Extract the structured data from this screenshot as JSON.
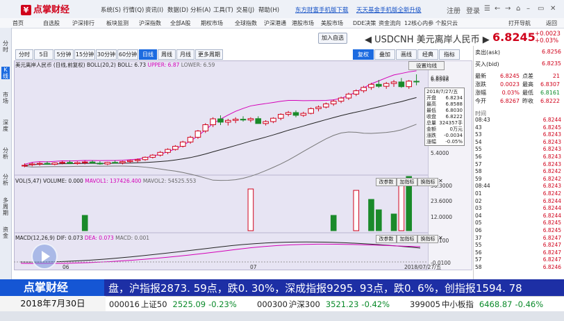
{
  "app": {
    "logo_text": "点掌财经",
    "brand_color": "#d0021b"
  },
  "menu": [
    "系统(S)",
    "行情(Q)",
    "资讯(I)",
    "数据(D)",
    "分析(A)",
    "工具(T)",
    "交易(J)",
    "帮助(H)"
  ],
  "top_links": [
    "东方财富手机版下载",
    "天天基金手机版全新升级"
  ],
  "top_right": [
    "注册",
    "登录"
  ],
  "nav": [
    "首页",
    "自选股",
    "沪深排行",
    "板块监测",
    "沪深指数",
    "全部A股",
    "期权市场",
    "全球指数",
    "沪深港通",
    "港股市场",
    "美股市场",
    "DDE决策",
    "资金流向",
    "12核心内参",
    "个股只云",
    "打开导航",
    "返回"
  ],
  "title": {
    "add_btn": "加入自选",
    "code": "USDCNH",
    "name": "美元离岸人民币",
    "price": "6.8245",
    "chg_abs": "+0.0023",
    "chg_pct": "+0.03%"
  },
  "sidebar": [
    "分时",
    "K线",
    "市场",
    "深度",
    "分析",
    "分析",
    "多周期",
    "资金"
  ],
  "chart_toolbar": [
    "分时",
    "5日",
    "5分钟",
    "15分钟",
    "30分钟",
    "60分钟",
    "日线",
    "周线",
    "月线",
    "更多周期"
  ],
  "chart_toolbar_right": [
    "复权",
    "叠加",
    "画线",
    "经典",
    "指标"
  ],
  "legend_main": {
    "name": "美元离岸人民币 (日线,前复权)",
    "boll": "BOLL(20,2)",
    "boll_val": "BOLL: 6.73",
    "upper": "UPPER: 6.87",
    "lower": "LOWER: 6.59"
  },
  "legend_vol": {
    "name": "VOL(5,47)",
    "vol": "VOLUME: 0.000",
    "mavol1": "MAVOL1: 137426.400",
    "mavol2": "MAVOL2: 54525.553"
  },
  "legend_macd": {
    "name": "MACD(12,26,9)",
    "dif": "DIF: 0.073",
    "dea": "DEA: 0.073",
    "macd": "MACD: 0.001"
  },
  "panel_buttons": [
    "改参数",
    "加指标",
    "换指标"
  ],
  "setting_btn": "设置均线",
  "popup": {
    "date": "2018/7/27/五",
    "rows": [
      [
        "开盘",
        "6.8234"
      ],
      [
        "最高",
        "6.8588"
      ],
      [
        "最低",
        "6.8030"
      ],
      [
        "收盘",
        "6.8222"
      ],
      [
        "总量",
        "324357手"
      ],
      [
        "金额",
        "0万元"
      ],
      [
        "涨跌",
        "-0.0034"
      ],
      [
        "涨幅",
        "-0.05%"
      ]
    ]
  },
  "price_axis": [
    "6.8302",
    "6.8568",
    "5.4000"
  ],
  "vol_axis": [
    "36.3000",
    "23.6000",
    "12.0000"
  ],
  "macd_axis": [
    "0.0100",
    "-0.0100"
  ],
  "x_axis": [
    "06",
    "07",
    "2018/07/27/五"
  ],
  "right_panel": {
    "sell_label": "卖出(ask)",
    "sell_val": "6.8256",
    "buy_label": "买入(bid)",
    "buy_val": "6.8235",
    "stats": [
      [
        "最新",
        "6.8245",
        "点差",
        "21"
      ],
      [
        "涨跌",
        "0.0023",
        "最高",
        "6.8307"
      ],
      [
        "涨幅",
        "0.03%",
        "最低",
        "6.8161"
      ],
      [
        "今开",
        "6.8267",
        "昨收",
        "6.8222"
      ]
    ],
    "tick_header": "时间",
    "ticks": [
      [
        "08:43",
        "6.8244"
      ],
      [
        "43",
        "6.8245"
      ],
      [
        "53",
        "6.8243"
      ],
      [
        "54",
        "6.8243"
      ],
      [
        "55",
        "6.8243"
      ],
      [
        "56",
        "6.8243"
      ],
      [
        "57",
        "6.8243"
      ],
      [
        "58",
        "6.8242"
      ],
      [
        "59",
        "6.8242"
      ],
      [
        "08:44",
        "6.8243"
      ],
      [
        "01",
        "6.8242"
      ],
      [
        "02",
        "6.8244"
      ],
      [
        "03",
        "6.8244"
      ],
      [
        "04",
        "6.8244"
      ],
      [
        "05",
        "6.8245"
      ],
      [
        "06",
        "6.8245"
      ],
      [
        "37",
        "6.8247"
      ],
      [
        "55",
        "6.8247"
      ],
      [
        "56",
        "6.8247"
      ],
      [
        "57",
        "6.8247"
      ],
      [
        "58",
        "6.8246"
      ]
    ]
  },
  "ticker": {
    "logo": "点掌财经",
    "text": "盘，沪指报2873. 59点，跌0. 30%，深成指报9295. 93点，跌0. 6%，创指报1594. 78"
  },
  "bottom": {
    "date": "2018年7月30日",
    "items": [
      {
        "code": "000016",
        "name": "上证50",
        "value": "2525.09",
        "pct": "-0.23%"
      },
      {
        "code": "000300",
        "name": "沪深300",
        "value": "3521.23",
        "pct": "-0.42%"
      },
      {
        "code": "399005",
        "name": "中小板指",
        "value": "6468.87",
        "pct": "-0.46%"
      }
    ]
  },
  "candles": [
    {
      "o": 6.392,
      "h": 6.405,
      "l": 6.385,
      "c": 6.395
    },
    {
      "o": 6.398,
      "h": 6.41,
      "l": 6.39,
      "c": 6.402
    },
    {
      "o": 6.401,
      "h": 6.412,
      "l": 6.393,
      "c": 6.405
    },
    {
      "o": 6.405,
      "h": 6.415,
      "l": 6.398,
      "c": 6.4
    },
    {
      "o": 6.4,
      "h": 6.41,
      "l": 6.395,
      "c": 6.407
    },
    {
      "o": 6.407,
      "h": 6.418,
      "l": 6.4,
      "c": 6.41
    },
    {
      "o": 6.41,
      "h": 6.42,
      "l": 6.402,
      "c": 6.404
    },
    {
      "o": 6.404,
      "h": 6.415,
      "l": 6.398,
      "c": 6.409
    },
    {
      "o": 6.409,
      "h": 6.418,
      "l": 6.4,
      "c": 6.412
    },
    {
      "o": 6.412,
      "h": 6.42,
      "l": 6.404,
      "c": 6.406
    },
    {
      "o": 6.406,
      "h": 6.416,
      "l": 6.398,
      "c": 6.402
    },
    {
      "o": 6.402,
      "h": 6.413,
      "l": 6.396,
      "c": 6.41
    },
    {
      "o": 6.41,
      "h": 6.42,
      "l": 6.404,
      "c": 6.408
    },
    {
      "o": 6.408,
      "h": 6.418,
      "l": 6.4,
      "c": 6.414
    },
    {
      "o": 6.414,
      "h": 6.425,
      "l": 6.407,
      "c": 6.419
    },
    {
      "o": 6.419,
      "h": 6.43,
      "l": 6.41,
      "c": 6.424
    },
    {
      "o": 6.424,
      "h": 6.44,
      "l": 6.418,
      "c": 6.436
    },
    {
      "o": 6.436,
      "h": 6.452,
      "l": 6.43,
      "c": 6.447
    },
    {
      "o": 6.447,
      "h": 6.468,
      "l": 6.44,
      "c": 6.461
    },
    {
      "o": 6.461,
      "h": 6.482,
      "l": 6.452,
      "c": 6.476
    },
    {
      "o": 6.476,
      "h": 6.498,
      "l": 6.47,
      "c": 6.492
    },
    {
      "o": 6.492,
      "h": 6.52,
      "l": 6.486,
      "c": 6.514
    },
    {
      "o": 6.514,
      "h": 6.545,
      "l": 6.505,
      "c": 6.538
    },
    {
      "o": 6.538,
      "h": 6.575,
      "l": 6.53,
      "c": 6.57
    },
    {
      "o": 6.57,
      "h": 6.61,
      "l": 6.56,
      "c": 6.602
    },
    {
      "o": 6.602,
      "h": 6.64,
      "l": 6.59,
      "c": 6.632
    },
    {
      "o": 6.632,
      "h": 6.65,
      "l": 6.6,
      "c": 6.615
    },
    {
      "o": 6.615,
      "h": 6.632,
      "l": 6.598,
      "c": 6.624
    },
    {
      "o": 6.624,
      "h": 6.64,
      "l": 6.61,
      "c": 6.63
    },
    {
      "o": 6.63,
      "h": 6.645,
      "l": 6.618,
      "c": 6.626
    },
    {
      "o": 6.626,
      "h": 6.64,
      "l": 6.615,
      "c": 6.633
    },
    {
      "o": 6.633,
      "h": 6.645,
      "l": 6.62,
      "c": 6.608
    },
    {
      "o": 6.608,
      "h": 6.625,
      "l": 6.598,
      "c": 6.618
    },
    {
      "o": 6.618,
      "h": 6.64,
      "l": 6.61,
      "c": 6.635
    },
    {
      "o": 6.635,
      "h": 6.66,
      "l": 6.625,
      "c": 6.655
    },
    {
      "o": 6.655,
      "h": 6.672,
      "l": 6.645,
      "c": 6.664
    },
    {
      "o": 6.664,
      "h": 6.675,
      "l": 6.64,
      "c": 6.65
    },
    {
      "o": 6.65,
      "h": 6.668,
      "l": 6.642,
      "c": 6.66
    },
    {
      "o": 6.66,
      "h": 6.69,
      "l": 6.655,
      "c": 6.684
    },
    {
      "o": 6.684,
      "h": 6.7,
      "l": 6.67,
      "c": 6.692
    },
    {
      "o": 6.692,
      "h": 6.715,
      "l": 6.685,
      "c": 6.708
    },
    {
      "o": 6.708,
      "h": 6.73,
      "l": 6.698,
      "c": 6.722
    },
    {
      "o": 6.722,
      "h": 6.745,
      "l": 6.712,
      "c": 6.738
    },
    {
      "o": 6.738,
      "h": 6.765,
      "l": 6.728,
      "c": 6.758
    },
    {
      "o": 6.758,
      "h": 6.782,
      "l": 6.748,
      "c": 6.775
    },
    {
      "o": 6.775,
      "h": 6.8,
      "l": 6.765,
      "c": 6.792
    },
    {
      "o": 6.792,
      "h": 6.815,
      "l": 6.78,
      "c": 6.808
    },
    {
      "o": 6.808,
      "h": 6.83,
      "l": 6.79,
      "c": 6.798
    },
    {
      "o": 6.798,
      "h": 6.82,
      "l": 6.785,
      "c": 6.812
    },
    {
      "o": 6.812,
      "h": 6.83,
      "l": 6.795,
      "c": 6.82
    },
    {
      "o": 6.82,
      "h": 6.84,
      "l": 6.79,
      "c": 6.796
    },
    {
      "o": 6.796,
      "h": 6.83,
      "l": 6.785,
      "c": 6.824
    },
    {
      "o": 6.8234,
      "h": 6.8588,
      "l": 6.803,
      "c": 6.8222
    }
  ]
}
